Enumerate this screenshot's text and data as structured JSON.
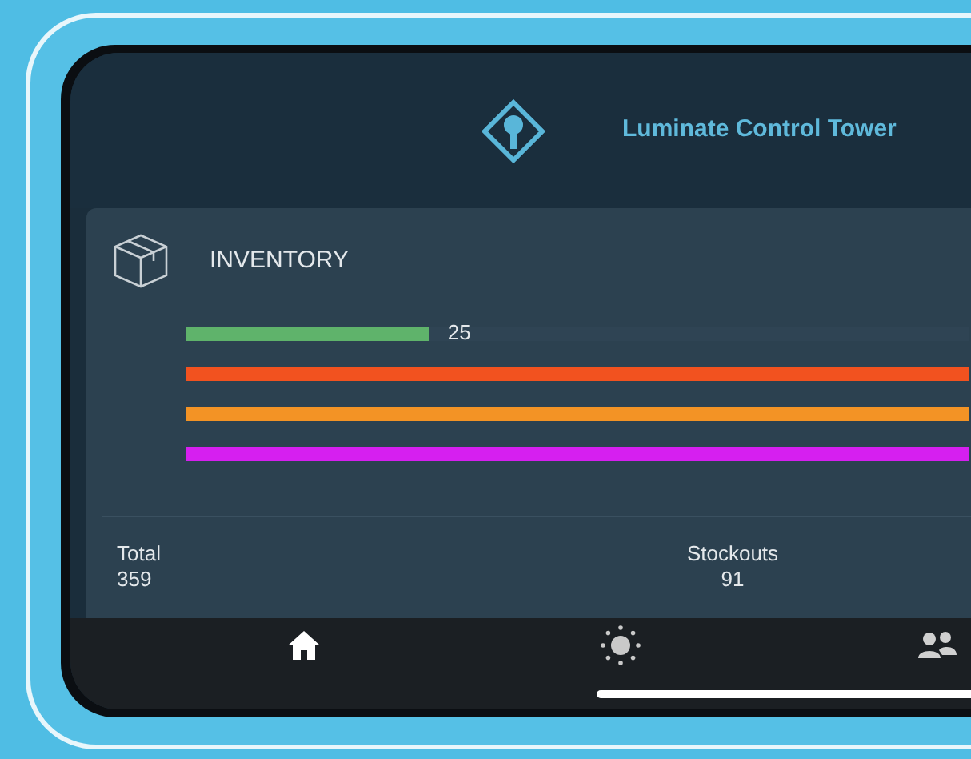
{
  "header": {
    "title": "Luminate Control Tower"
  },
  "card": {
    "title": "INVENTORY",
    "bars": [
      {
        "level": 0.31,
        "color": "#5fb36b",
        "value": "25"
      },
      {
        "color": "#f2521f"
      },
      {
        "color": "#f39325"
      },
      {
        "color": "#d61ff0"
      }
    ],
    "stats": [
      {
        "label": "Total",
        "value": "359"
      },
      {
        "label": "Stockouts",
        "value": "91"
      }
    ]
  },
  "nav": [
    {
      "kind": "home"
    },
    {
      "kind": "sun"
    },
    {
      "kind": "people"
    }
  ]
}
